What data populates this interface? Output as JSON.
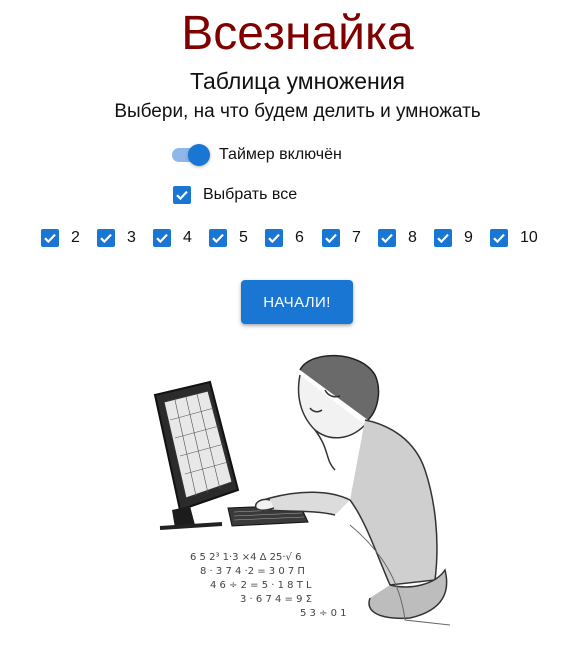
{
  "header": {
    "app_title": "Всезнайка",
    "subtitle": "Таблица умножения",
    "instruction": "Выбери, на что будем делить и умножать"
  },
  "timer_switch": {
    "label": "Таймер включён",
    "checked": true
  },
  "select_all": {
    "label": "Выбрать все",
    "checked": true
  },
  "numbers": [
    {
      "label": "2",
      "checked": true
    },
    {
      "label": "3",
      "checked": true
    },
    {
      "label": "4",
      "checked": true
    },
    {
      "label": "5",
      "checked": true
    },
    {
      "label": "6",
      "checked": true
    },
    {
      "label": "7",
      "checked": true
    },
    {
      "label": "8",
      "checked": true
    },
    {
      "label": "9",
      "checked": true
    },
    {
      "label": "10",
      "checked": true
    }
  ],
  "start_button": {
    "label": "НАЧАЛИ!"
  },
  "colors": {
    "title": "#800000",
    "accent": "#1976d2",
    "switch_track": "#8fb7ea"
  },
  "illustration": {
    "icon": "boy-at-computer-sketch"
  }
}
